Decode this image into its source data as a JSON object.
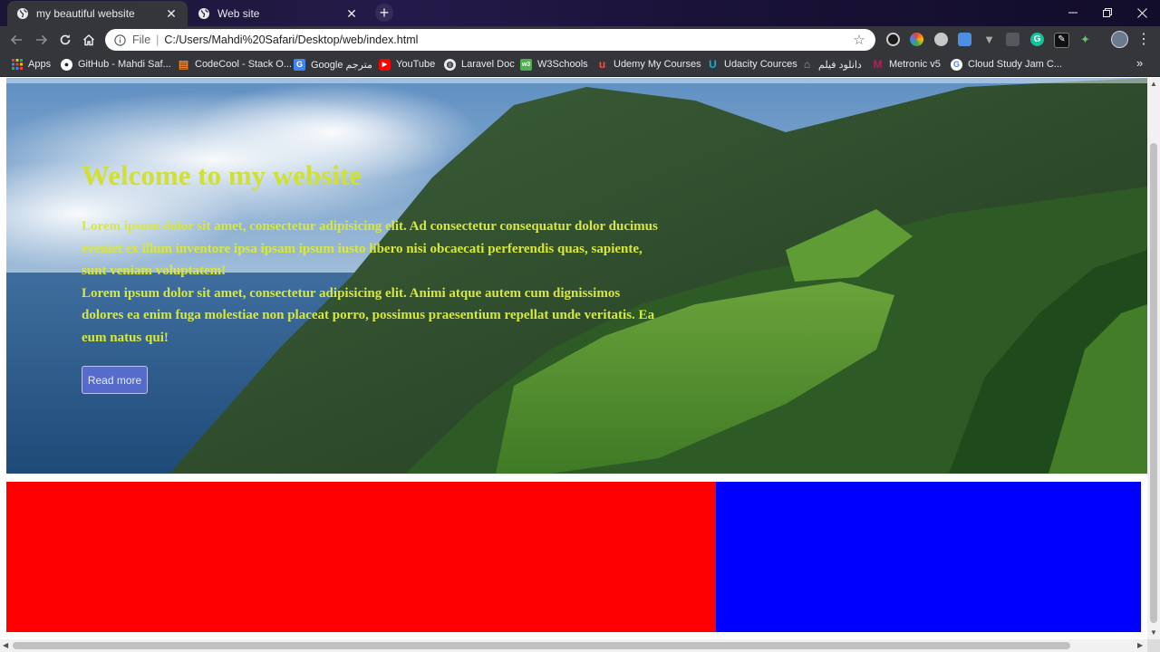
{
  "browser": {
    "tabs": [
      {
        "title": "my beautiful website",
        "active": true
      },
      {
        "title": "Web site",
        "active": false
      }
    ],
    "address": {
      "scheme_label": "File",
      "url": "C:/Users/Mahdi%20Safari/Desktop/web/index.html"
    },
    "bookmarks": [
      {
        "label": "Apps",
        "icon": "apps-grid-icon",
        "color": "#e8eaed"
      },
      {
        "label": "GitHub - Mahdi Saf...",
        "icon": "github-icon",
        "color": "#ffffff"
      },
      {
        "label": "CodeCool - Stack O...",
        "icon": "codecool-icon",
        "color": "#f48024"
      },
      {
        "label": "Google مترجم",
        "icon": "google-translate-icon",
        "color": "#4285f4"
      },
      {
        "label": "YouTube",
        "icon": "youtube-icon",
        "color": "#ff0000"
      },
      {
        "label": "Laravel Doc",
        "icon": "globe-icon",
        "color": "#e8eaed"
      },
      {
        "label": "W3Schools",
        "icon": "w3schools-icon",
        "color": "#4caf50"
      },
      {
        "label": "Udemy My Courses",
        "icon": "udemy-icon",
        "color": "#ec5252"
      },
      {
        "label": "Udacity Cources",
        "icon": "udacity-icon",
        "color": "#02b3e4"
      },
      {
        "label": "دانلود فیلم",
        "icon": "film-icon",
        "color": "#9aa0a6"
      },
      {
        "label": "Metronic v5",
        "icon": "metronic-icon",
        "color": "#c2185b"
      },
      {
        "label": "Cloud Study Jam C...",
        "icon": "google-icon",
        "color": "#e8eaed"
      }
    ],
    "more_label": "»"
  },
  "page": {
    "hero": {
      "title": "Welcome to my website",
      "paragraph1": "Lorem ipsum dolor sit amet, consectetur adipisicing elit. Ad consectetur consequatur dolor ducimus eveniet ex illum inventore ipsa ipsam ipsum iusto libero nisi obcaecati perferendis quas, sapiente, sunt veniam voluptatem!",
      "paragraph2": "Lorem ipsum dolor sit amet, consectetur adipisicing elit. Animi atque autem cum dignissimos dolores ea enim fuga molestiae non placeat porro, possimus praesentium repellat unde veritatis. Ea eum natus qui!",
      "button_label": "Read more"
    },
    "blocks": [
      {
        "name": "red-block",
        "color": "#ff0000"
      },
      {
        "name": "blue-block",
        "color": "#0000ff"
      }
    ]
  }
}
